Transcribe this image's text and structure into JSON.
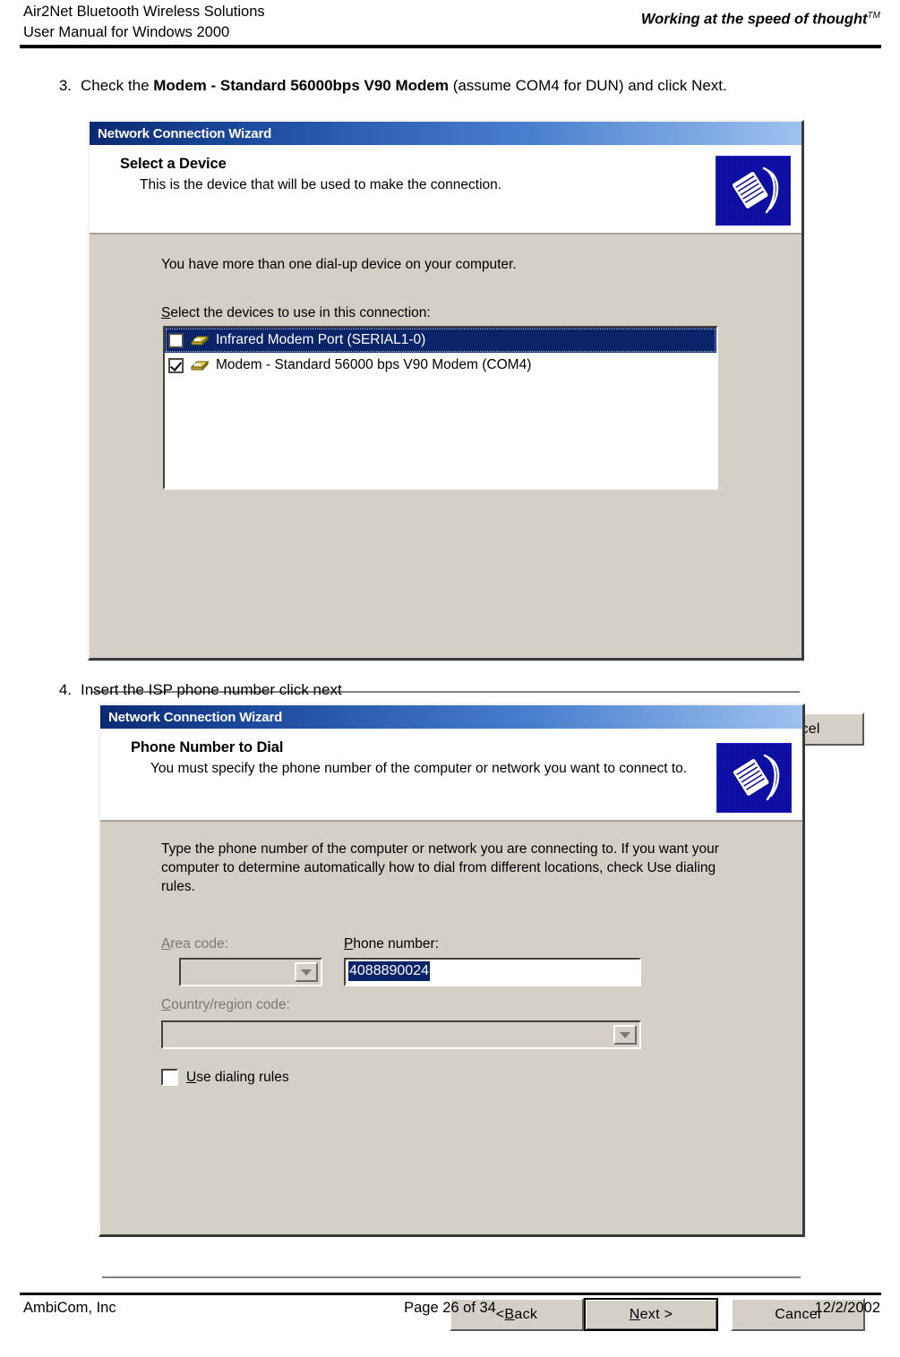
{
  "header": {
    "line1": "Air2Net Bluetooth Wireless Solutions",
    "line2": "User Manual for Windows 2000",
    "tagline": "Working at the speed of thought",
    "tagline_tm": "TM"
  },
  "steps": [
    {
      "number": "3.",
      "text_before": "Check the ",
      "text_bold": "Modem - Standard 56000bps V90 Modem",
      "text_after": " (assume COM4 for DUN) and click Next."
    },
    {
      "number": "4.",
      "text": "Insert the ISP phone number click next"
    }
  ],
  "dialog_select_device": {
    "titlebar": "Network Connection Wizard",
    "heading": "Select a Device",
    "subheading": "This is the device that will be used to make the connection.",
    "icon": "network-connection-icon",
    "intro": "You have more than one dial-up device on your computer.",
    "list_label_prefix": "S",
    "list_label_rest": "elect the devices to use in this connection:",
    "devices": [
      {
        "label": "Infrared Modem Port (SERIAL1-0)",
        "checked": false,
        "selected": true
      },
      {
        "label": "Modem - Standard 56000 bps V90 Modem (COM4)",
        "checked": true,
        "selected": false
      }
    ],
    "buttons": {
      "back_prefix": "< ",
      "back_accel": "B",
      "back_rest": "ack",
      "next_accel": "N",
      "next_rest": "ext >",
      "cancel": "Cancel"
    }
  },
  "dialog_phone_number": {
    "titlebar": "Network Connection Wizard",
    "heading": "Phone Number to Dial",
    "subheading": "You must specify the phone number of the computer or network you want to connect to.",
    "icon": "network-connection-icon",
    "intro": "Type the phone number of the computer or network you are connecting to. If you want your computer to determine automatically how to dial from different locations, check Use dialing rules.",
    "area_code": {
      "label_accel": "A",
      "label_rest": "rea code:",
      "value": ""
    },
    "phone_number": {
      "label_accel": "P",
      "label_rest": "hone number:",
      "value": "4088890024",
      "selected": true
    },
    "country_code": {
      "label_accel": "C",
      "label_rest": "ountry/region code:",
      "value": ""
    },
    "use_dialing_rules": {
      "label_accel": "U",
      "label_rest": "se dialing rules",
      "checked": false
    },
    "buttons": {
      "back_prefix": "< ",
      "back_accel": "B",
      "back_rest": "ack",
      "next_accel": "N",
      "next_rest": "ext >",
      "cancel": "Cancel"
    }
  },
  "footer": {
    "company": "AmbiCom, Inc",
    "page": "Page 26 of 34",
    "date": "12/2/2002"
  },
  "colors": {
    "titlebar_dark": "#0a2a72",
    "titlebar_light": "#9dc2ee",
    "dialog_face": "#d4d0c8",
    "selection": "#0a246a",
    "icon_bg": "#0b0b8f"
  }
}
